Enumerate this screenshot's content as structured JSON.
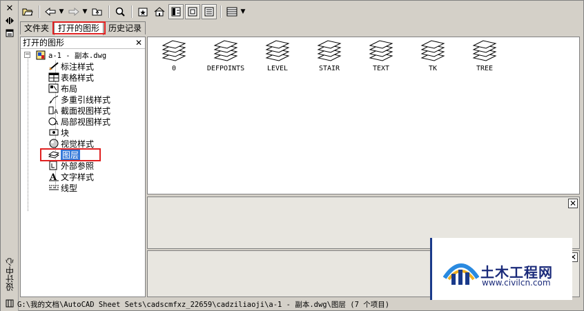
{
  "sidebar_title": "设计中心",
  "tabs": [
    {
      "label": "文件夹"
    },
    {
      "label": "打开的图形"
    },
    {
      "label": "历史记录"
    }
  ],
  "tree": {
    "header": "打开的图形",
    "root": "a-1 - 副本.dwg",
    "items": [
      {
        "label": "标注样式",
        "icon": "dimension-style-icon"
      },
      {
        "label": "表格样式",
        "icon": "table-style-icon"
      },
      {
        "label": "布局",
        "icon": "layout-icon"
      },
      {
        "label": "多重引线样式",
        "icon": "multileader-style-icon"
      },
      {
        "label": "截面视图样式",
        "icon": "section-view-style-icon"
      },
      {
        "label": "局部视图样式",
        "icon": "detail-view-style-icon"
      },
      {
        "label": "块",
        "icon": "block-icon"
      },
      {
        "label": "视觉样式",
        "icon": "visual-style-icon"
      },
      {
        "label": "图层",
        "icon": "layer-icon"
      },
      {
        "label": "外部参照",
        "icon": "xref-icon"
      },
      {
        "label": "文字样式",
        "icon": "text-style-icon"
      },
      {
        "label": "线型",
        "icon": "linetype-icon"
      }
    ],
    "selected": "图层"
  },
  "layers": [
    "0",
    "DEFPOINTS",
    "LEVEL",
    "STAIR",
    "TEXT",
    "TK",
    "TREE"
  ],
  "status": "G:\\我的文档\\AutoCAD Sheet Sets\\cadscmfxz_22659\\cadziliaoji\\a-1 - 副本.dwg\\图层 (7 个项目)",
  "watermark": {
    "title": "土木工程网",
    "url": "www.civilcn.com"
  },
  "colors": {
    "highlight": "#e02020",
    "selection": "#3478d8"
  }
}
